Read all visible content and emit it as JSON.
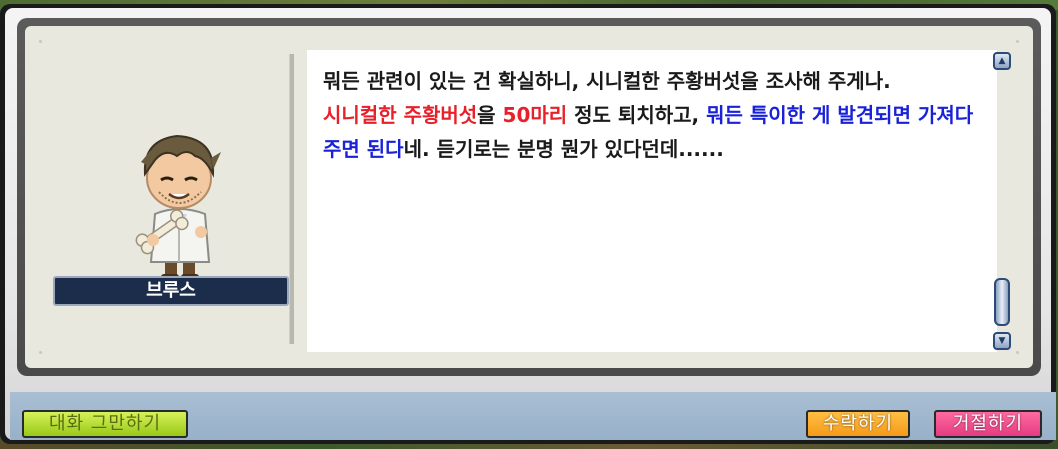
{
  "npc": {
    "name": "브루스"
  },
  "dialogue": {
    "line1": "뭐든 관련이 있는 건 확실하니, 시니컬한 주황버섯을 조사해 주게나.",
    "target_mob": "시니컬한 주황버섯",
    "particle_eul": "을 ",
    "target_count": "50마리",
    "mid_text": " 정도 퇴치하고, ",
    "request": "뭐든 특이한 게 발견되면 가져다 주면 된다",
    "tail": "네. 듣기로는 분명 뭔가 있다던데......"
  },
  "buttons": {
    "end_chat": "대화 그만하기",
    "accept": "수락하기",
    "decline": "거절하기"
  },
  "colors": {
    "highlight_red": "#e8202a",
    "highlight_blue": "#1a22d8",
    "name_plate": "#1c2d4c",
    "end_chat_button": "#b5dc30",
    "accept_button": "#f7a52a",
    "decline_button": "#ef4a8e"
  },
  "icons": {
    "scroll_up": "arrow-up-icon",
    "scroll_down": "arrow-down-icon"
  }
}
